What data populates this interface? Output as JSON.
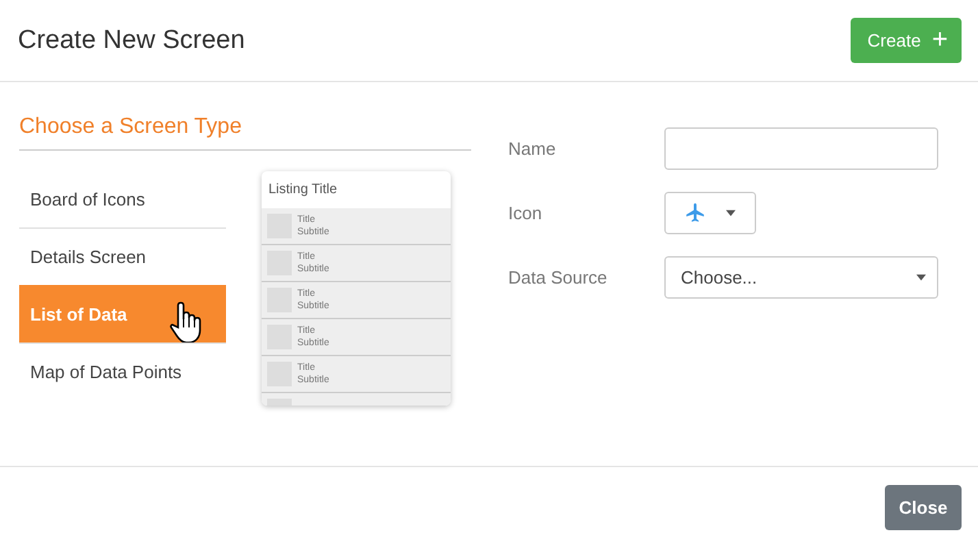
{
  "dialog": {
    "title": "Create New Screen",
    "create_button": "Create",
    "plus_icon": "+",
    "close_button": "Close"
  },
  "screen_types": {
    "heading": "Choose a Screen Type",
    "items": [
      {
        "label": "Board of Icons",
        "selected": false
      },
      {
        "label": "Details Screen",
        "selected": false
      },
      {
        "label": "List of Data",
        "selected": true
      },
      {
        "label": "Map of Data Points",
        "selected": false
      }
    ]
  },
  "preview": {
    "title": "Listing Title",
    "rows": [
      {
        "title": "Title",
        "subtitle": "Subtitle"
      },
      {
        "title": "Title",
        "subtitle": "Subtitle"
      },
      {
        "title": "Title",
        "subtitle": "Subtitle"
      },
      {
        "title": "Title",
        "subtitle": "Subtitle"
      },
      {
        "title": "Title",
        "subtitle": "Subtitle"
      }
    ]
  },
  "form": {
    "fields": [
      {
        "kind": "text",
        "label": "Name"
      },
      {
        "kind": "icon",
        "label": "Icon"
      },
      {
        "kind": "select",
        "label": "Data Source",
        "value": "Choose..."
      }
    ]
  }
}
